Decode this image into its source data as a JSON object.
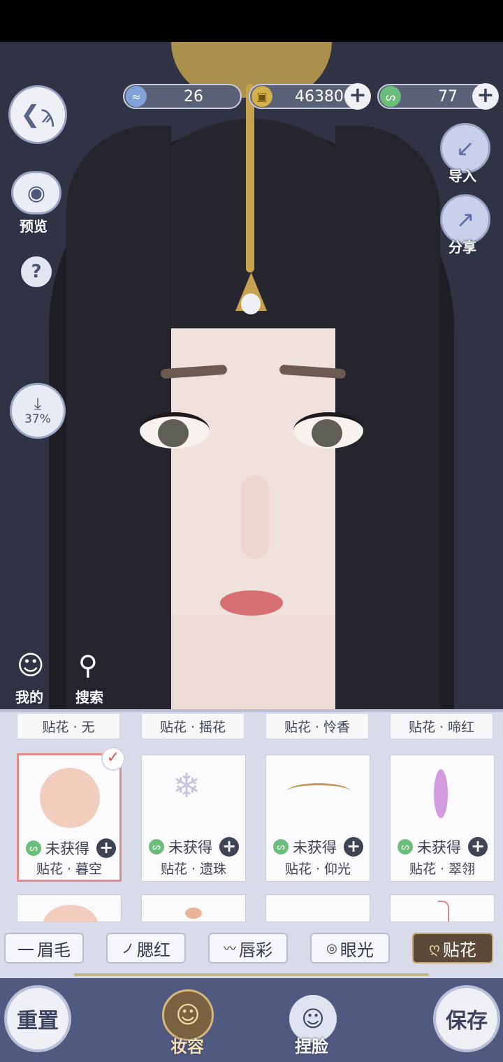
{
  "currency": [
    {
      "icon": "feather-token-icon",
      "value": "26"
    },
    {
      "icon": "coin-icon",
      "value": "46380"
    },
    {
      "icon": "jade-icon",
      "value": "77"
    }
  ],
  "left_controls": {
    "preview_label": "预览",
    "help_symbol": "?",
    "download_percent": "37%"
  },
  "right_controls": {
    "import_label": "导入",
    "share_label": "分享"
  },
  "quick": {
    "mine_label": "我的",
    "search_label": "搜索"
  },
  "stickers_row0": [
    "贴花 · 无",
    "贴花 · 摇花",
    "贴花 · 怜香",
    "贴花 · 啼红"
  ],
  "stickers_row1": [
    {
      "name": "贴花 · 暮空",
      "status": "未获得",
      "selected": true
    },
    {
      "name": "贴花 · 遗珠",
      "status": "未获得",
      "selected": false
    },
    {
      "name": "贴花 · 仰光",
      "status": "未获得",
      "selected": false
    },
    {
      "name": "贴花 · 翠翎",
      "status": "未获得",
      "selected": false
    }
  ],
  "tabs": [
    {
      "label": "眉毛",
      "glyph": "一"
    },
    {
      "label": "腮红",
      "glyph": "ノ"
    },
    {
      "label": "唇彩",
      "glyph": "〰"
    },
    {
      "label": "眼光",
      "glyph": "◎"
    },
    {
      "label": "贴花",
      "glyph": "ღ",
      "active": true
    }
  ],
  "bottom": {
    "reset_label": "重置",
    "makeup_label": "妆容",
    "face_label": "捏脸",
    "save_label": "保存"
  },
  "colors": {
    "scene_bg": "#2f3344",
    "panel_bg": "#d8dcea",
    "bottom_bar": "#505a80",
    "active_tab": "#5b4a3a",
    "gold_accent": "#c6a66c"
  }
}
